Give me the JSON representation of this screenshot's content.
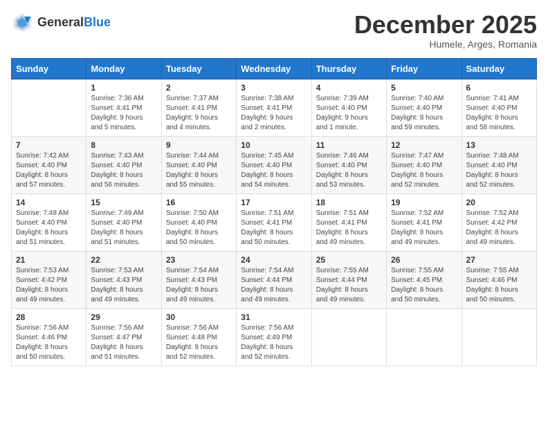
{
  "header": {
    "logo_general": "General",
    "logo_blue": "Blue",
    "month_title": "December 2025",
    "subtitle": "Humele, Arges, Romania"
  },
  "days_of_week": [
    "Sunday",
    "Monday",
    "Tuesday",
    "Wednesday",
    "Thursday",
    "Friday",
    "Saturday"
  ],
  "weeks": [
    [
      {
        "num": "",
        "info": ""
      },
      {
        "num": "1",
        "info": "Sunrise: 7:36 AM\nSunset: 4:41 PM\nDaylight: 9 hours\nand 5 minutes."
      },
      {
        "num": "2",
        "info": "Sunrise: 7:37 AM\nSunset: 4:41 PM\nDaylight: 9 hours\nand 4 minutes."
      },
      {
        "num": "3",
        "info": "Sunrise: 7:38 AM\nSunset: 4:41 PM\nDaylight: 9 hours\nand 2 minutes."
      },
      {
        "num": "4",
        "info": "Sunrise: 7:39 AM\nSunset: 4:40 PM\nDaylight: 9 hours\nand 1 minute."
      },
      {
        "num": "5",
        "info": "Sunrise: 7:40 AM\nSunset: 4:40 PM\nDaylight: 8 hours\nand 59 minutes."
      },
      {
        "num": "6",
        "info": "Sunrise: 7:41 AM\nSunset: 4:40 PM\nDaylight: 8 hours\nand 58 minutes."
      }
    ],
    [
      {
        "num": "7",
        "info": "Sunrise: 7:42 AM\nSunset: 4:40 PM\nDaylight: 8 hours\nand 57 minutes."
      },
      {
        "num": "8",
        "info": "Sunrise: 7:43 AM\nSunset: 4:40 PM\nDaylight: 8 hours\nand 56 minutes."
      },
      {
        "num": "9",
        "info": "Sunrise: 7:44 AM\nSunset: 4:40 PM\nDaylight: 8 hours\nand 55 minutes."
      },
      {
        "num": "10",
        "info": "Sunrise: 7:45 AM\nSunset: 4:40 PM\nDaylight: 8 hours\nand 54 minutes."
      },
      {
        "num": "11",
        "info": "Sunrise: 7:46 AM\nSunset: 4:40 PM\nDaylight: 8 hours\nand 53 minutes."
      },
      {
        "num": "12",
        "info": "Sunrise: 7:47 AM\nSunset: 4:40 PM\nDaylight: 8 hours\nand 52 minutes."
      },
      {
        "num": "13",
        "info": "Sunrise: 7:48 AM\nSunset: 4:40 PM\nDaylight: 8 hours\nand 52 minutes."
      }
    ],
    [
      {
        "num": "14",
        "info": "Sunrise: 7:48 AM\nSunset: 4:40 PM\nDaylight: 8 hours\nand 51 minutes."
      },
      {
        "num": "15",
        "info": "Sunrise: 7:49 AM\nSunset: 4:40 PM\nDaylight: 8 hours\nand 51 minutes."
      },
      {
        "num": "16",
        "info": "Sunrise: 7:50 AM\nSunset: 4:40 PM\nDaylight: 8 hours\nand 50 minutes."
      },
      {
        "num": "17",
        "info": "Sunrise: 7:51 AM\nSunset: 4:41 PM\nDaylight: 8 hours\nand 50 minutes."
      },
      {
        "num": "18",
        "info": "Sunrise: 7:51 AM\nSunset: 4:41 PM\nDaylight: 8 hours\nand 49 minutes."
      },
      {
        "num": "19",
        "info": "Sunrise: 7:52 AM\nSunset: 4:41 PM\nDaylight: 8 hours\nand 49 minutes."
      },
      {
        "num": "20",
        "info": "Sunrise: 7:52 AM\nSunset: 4:42 PM\nDaylight: 8 hours\nand 49 minutes."
      }
    ],
    [
      {
        "num": "21",
        "info": "Sunrise: 7:53 AM\nSunset: 4:42 PM\nDaylight: 8 hours\nand 49 minutes."
      },
      {
        "num": "22",
        "info": "Sunrise: 7:53 AM\nSunset: 4:43 PM\nDaylight: 8 hours\nand 49 minutes."
      },
      {
        "num": "23",
        "info": "Sunrise: 7:54 AM\nSunset: 4:43 PM\nDaylight: 8 hours\nand 49 minutes."
      },
      {
        "num": "24",
        "info": "Sunrise: 7:54 AM\nSunset: 4:44 PM\nDaylight: 8 hours\nand 49 minutes."
      },
      {
        "num": "25",
        "info": "Sunrise: 7:55 AM\nSunset: 4:44 PM\nDaylight: 8 hours\nand 49 minutes."
      },
      {
        "num": "26",
        "info": "Sunrise: 7:55 AM\nSunset: 4:45 PM\nDaylight: 8 hours\nand 50 minutes."
      },
      {
        "num": "27",
        "info": "Sunrise: 7:55 AM\nSunset: 4:46 PM\nDaylight: 8 hours\nand 50 minutes."
      }
    ],
    [
      {
        "num": "28",
        "info": "Sunrise: 7:56 AM\nSunset: 4:46 PM\nDaylight: 8 hours\nand 50 minutes."
      },
      {
        "num": "29",
        "info": "Sunrise: 7:56 AM\nSunset: 4:47 PM\nDaylight: 8 hours\nand 51 minutes."
      },
      {
        "num": "30",
        "info": "Sunrise: 7:56 AM\nSunset: 4:48 PM\nDaylight: 8 hours\nand 52 minutes."
      },
      {
        "num": "31",
        "info": "Sunrise: 7:56 AM\nSunset: 4:49 PM\nDaylight: 8 hours\nand 52 minutes."
      },
      {
        "num": "",
        "info": ""
      },
      {
        "num": "",
        "info": ""
      },
      {
        "num": "",
        "info": ""
      }
    ]
  ]
}
